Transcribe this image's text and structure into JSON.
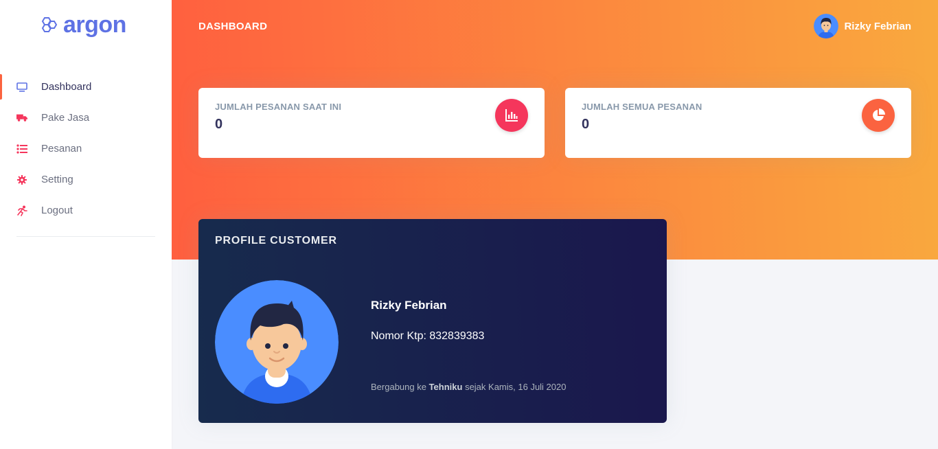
{
  "brand": {
    "name": "argon",
    "color": "#5e72e4"
  },
  "sidebar": {
    "items": [
      {
        "label": "Dashboard",
        "icon": "monitor-icon",
        "active": true
      },
      {
        "label": "Pake Jasa",
        "icon": "truck-icon",
        "active": false
      },
      {
        "label": "Pesanan",
        "icon": "list-icon",
        "active": false
      },
      {
        "label": "Setting",
        "icon": "gear-icon",
        "active": false
      },
      {
        "label": "Logout",
        "icon": "running-person-icon",
        "active": false
      }
    ]
  },
  "header": {
    "title": "DASHBOARD",
    "user_name": "Rizky Febrian",
    "gradient": [
      "#ff5f3f",
      "#f9a93e"
    ]
  },
  "stats": [
    {
      "title": "JUMLAH PESANAN SAAT INI",
      "value": "0",
      "icon": "bar-chart-icon",
      "color": "#f5365c"
    },
    {
      "title": "JUMLAH SEMUA PESANAN",
      "value": "0",
      "icon": "pie-chart-icon",
      "color": "#fb6340"
    }
  ],
  "profile": {
    "title": "PROFILE CUSTOMER",
    "name": "Rizky Febrian",
    "ktp": "Nomor Ktp: 832839383",
    "joined_prefix": "Bergabung ke ",
    "joined_company": "Tehniku",
    "joined_suffix": " sejak Kamis, 16 Juli 2020"
  }
}
